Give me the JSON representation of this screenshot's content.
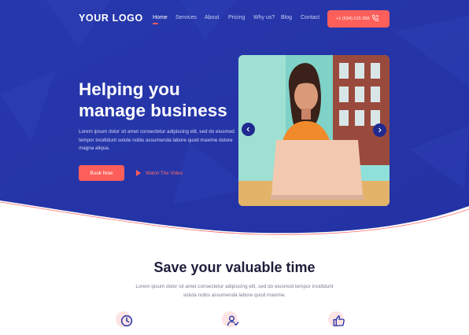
{
  "header": {
    "logo": "YOUR LOGO",
    "nav": [
      {
        "label": "Home",
        "active": true
      },
      {
        "label": "Services",
        "active": false
      },
      {
        "label": "About",
        "active": false
      },
      {
        "label": "Pricing",
        "active": false
      },
      {
        "label": "Why us?",
        "active": false
      },
      {
        "label": "Blog",
        "active": false
      },
      {
        "label": "Contact",
        "active": false
      }
    ],
    "phone": "+1 (534) 215 356",
    "phone_icon": "phone-icon"
  },
  "hero": {
    "title_line1": "Helping you",
    "title_line2": "manage business",
    "description": "Lorem ipsum dolor sit amet consectetur adipiscing elit, sed do eiusmod tempor incididunt solute nobis assumenda labore quod maxime dolore magna aliqua.",
    "primary_button": "Book Now",
    "video_link": "Watch The Video",
    "image_alt": "woman-with-laptop-photo",
    "prev_icon": "chevron-left-icon",
    "next_icon": "chevron-right-icon"
  },
  "features_section": {
    "title": "Save your valuable time",
    "description": "Lorem ipsum dolor sit amet consectetur adipiscing elit, sed do eiusmod tempor incididunt soluta nobis assumenda labore quod maxime.",
    "icons": [
      "clock-icon",
      "user-check-icon",
      "thumbs-up-icon"
    ]
  },
  "colors": {
    "primary": "#2432a6",
    "accent": "#fe5f5a",
    "heading": "#1c1e3a"
  }
}
